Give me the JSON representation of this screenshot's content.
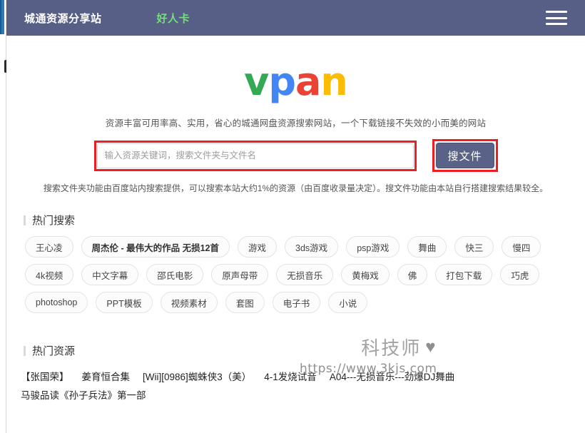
{
  "header": {
    "brand": "城通资源分享站",
    "nav_link": "好人卡",
    "menu_icon": "hamburger-menu-icon"
  },
  "hero": {
    "logo_letters": [
      "v",
      "p",
      "a",
      "n"
    ],
    "logo_colors": [
      "#34a853",
      "#4285f4",
      "#ea4335",
      "#fbbc05"
    ],
    "tagline": "资源丰富可用率高、实用，省心的城通网盘资源搜索网站，一个下载链接不失效的小而美的网站"
  },
  "search": {
    "placeholder": "输入资源关键词，搜索文件夹与文件名",
    "value": "",
    "button_label": "搜文件",
    "highlight_color": "#ee1c23",
    "note": "搜索文件夹功能由百度站内搜索提供，可以搜索本站大约1%的资源（由百度收录量决定）。搜文件功能由本站自行搭建搜索结果较全。"
  },
  "hot_search": {
    "title": "热门搜索",
    "tags": [
      {
        "label": "王心凌",
        "bold": false
      },
      {
        "label": "周杰伦 - 最伟大的作品 无损12首",
        "bold": true
      },
      {
        "label": "游戏",
        "bold": false
      },
      {
        "label": "3ds游戏",
        "bold": false
      },
      {
        "label": "psp游戏",
        "bold": false
      },
      {
        "label": "舞曲",
        "bold": false
      },
      {
        "label": "快三",
        "bold": false
      },
      {
        "label": "慢四",
        "bold": false
      },
      {
        "label": "4k视频",
        "bold": false
      },
      {
        "label": "中文字幕",
        "bold": false
      },
      {
        "label": "邵氏电影",
        "bold": false
      },
      {
        "label": "原声母带",
        "bold": false
      },
      {
        "label": "无损音乐",
        "bold": false
      },
      {
        "label": "黄梅戏",
        "bold": false
      },
      {
        "label": "佛",
        "bold": false
      },
      {
        "label": "打包下载",
        "bold": false
      },
      {
        "label": "巧虎",
        "bold": false
      },
      {
        "label": "photoshop",
        "bold": false
      },
      {
        "label": "PPT模板",
        "bold": false
      },
      {
        "label": "视频素材",
        "bold": false
      },
      {
        "label": "套图",
        "bold": false
      },
      {
        "label": "电子书",
        "bold": false
      },
      {
        "label": "小说",
        "bold": false
      }
    ]
  },
  "hot_resources": {
    "title": "热门资源",
    "links": [
      "【张国荣】",
      "姜育恒合集",
      "[Wii][0986]蜘蛛侠3（美）",
      "4-1发烧试音",
      "A04---无损音乐---劲爆DJ舞曲",
      "马骏品读《孙子兵法》第一部"
    ]
  },
  "watermark": {
    "text": "科技师",
    "heart": "♥",
    "url": "https://www.3kjs.com"
  }
}
